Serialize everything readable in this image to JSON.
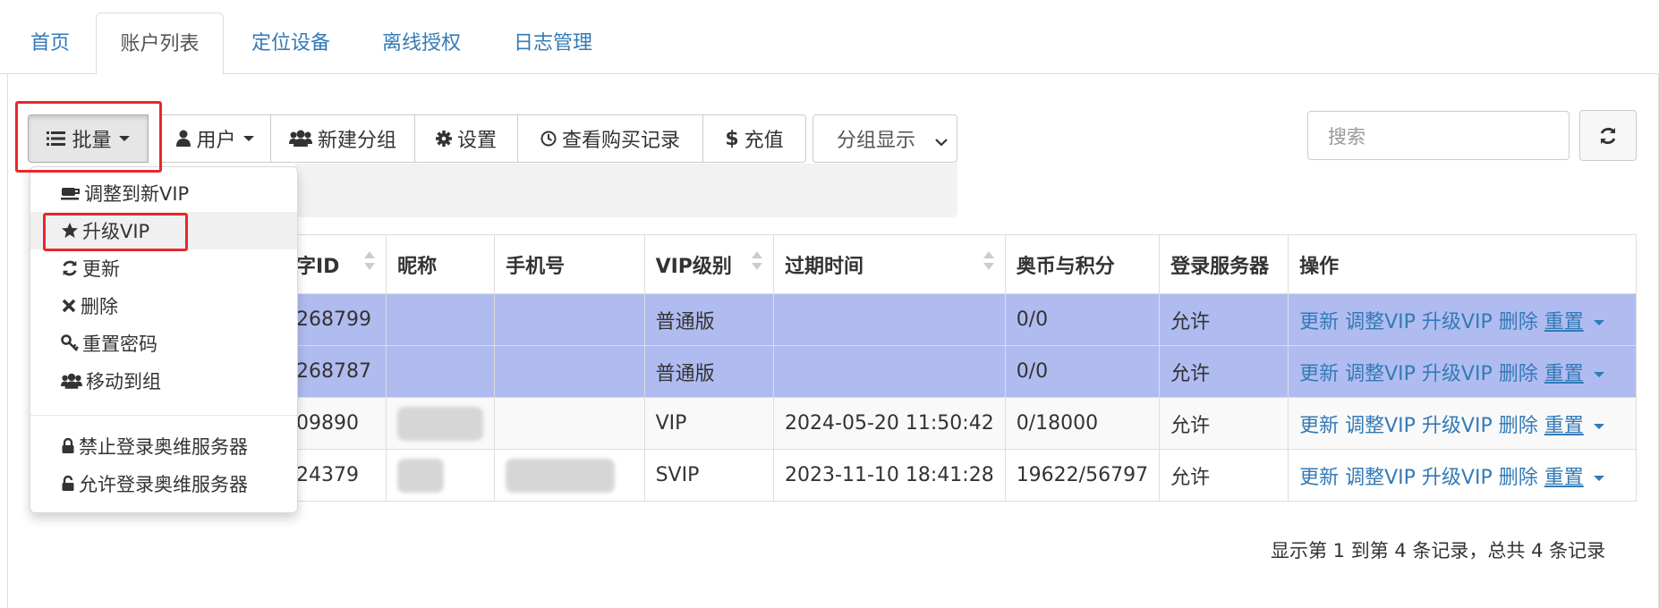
{
  "tabs": [
    {
      "label": "首页"
    },
    {
      "label": "账户列表"
    },
    {
      "label": "定位设备"
    },
    {
      "label": "离线授权"
    },
    {
      "label": "日志管理"
    }
  ],
  "toolbar": {
    "batch_label": "批量",
    "user_label": "用户",
    "new_group_label": "新建分组",
    "settings_label": "设置",
    "purchase_records_label": "查看购买记录",
    "recharge_label": "充值",
    "group_display_value": "分组显示",
    "search_placeholder": "搜索"
  },
  "batch_menu": {
    "items": [
      {
        "label": "调整到新VIP",
        "icon": "coffee-icon"
      },
      {
        "label": "升级VIP",
        "icon": "star-icon"
      },
      {
        "label": "更新",
        "icon": "refresh-icon"
      },
      {
        "label": "删除",
        "icon": "close-icon"
      },
      {
        "label": "重置密码",
        "icon": "key-icon"
      },
      {
        "label": "移动到组",
        "icon": "users-icon"
      },
      {
        "label": "禁止登录奥维服务器",
        "icon": "lock-icon"
      },
      {
        "label": "允许登录奥维服务器",
        "icon": "unlock-icon"
      }
    ]
  },
  "table": {
    "columns": [
      "字ID",
      "昵称",
      "手机号",
      "VIP级别",
      "过期时间",
      "奥币与积分",
      "登录服务器",
      "操作"
    ],
    "rows": [
      {
        "id": "268799",
        "nickname": "",
        "phone": "",
        "vip": "普通版",
        "expire": "",
        "coins": "0/0",
        "login": "允许"
      },
      {
        "id": "268787",
        "nickname": "",
        "phone": "",
        "vip": "普通版",
        "expire": "",
        "coins": "0/0",
        "login": "允许"
      },
      {
        "id": "09890",
        "nickname": "",
        "phone": "",
        "vip": "VIP",
        "expire": "2024-05-20 11:50:42",
        "coins": "0/18000",
        "login": "允许"
      },
      {
        "id": "24379",
        "nickname": "",
        "phone": "",
        "vip": "SVIP",
        "expire": "2023-11-10 18:41:28",
        "coins": "19622/56797",
        "login": "允许"
      }
    ],
    "actions": {
      "update": "更新",
      "adjust_vip": "调整VIP",
      "upgrade_vip": "升级VIP",
      "delete": "删除",
      "reset": "重置"
    }
  },
  "pagination_text": "显示第 1 到第 4 条记录，总共 4 条记录",
  "colors": {
    "link": "#337ab7",
    "selected_row": "#b0bcf0",
    "annotation": "#e8272a"
  }
}
